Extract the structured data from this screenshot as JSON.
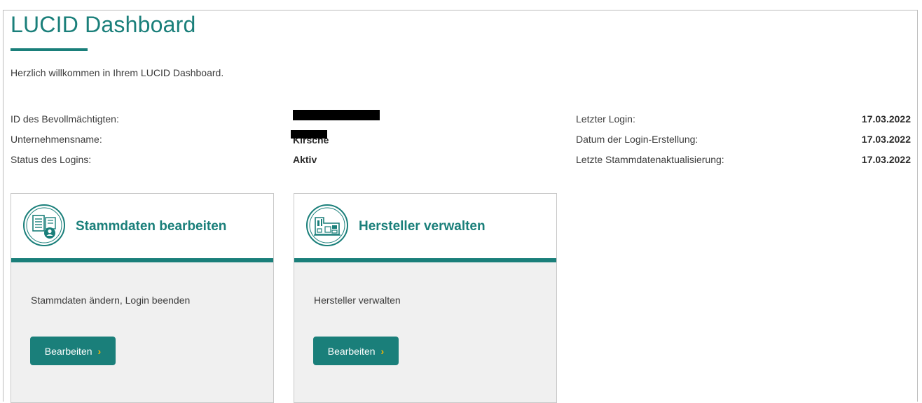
{
  "page": {
    "title": "LUCID Dashboard",
    "welcome": "Herzlich willkommen in Ihrem LUCID Dashboard."
  },
  "info_left": [
    {
      "label": "ID des Bevollmächtigten:",
      "value": "",
      "redacted": true
    },
    {
      "label": "Unternehmensname:",
      "value": "Kirsche",
      "redacted": true
    },
    {
      "label": "Status des Logins:",
      "value": "Aktiv",
      "redacted": false
    }
  ],
  "info_right": [
    {
      "label": "Letzter Login:",
      "value": "17.03.2022"
    },
    {
      "label": "Datum der Login-Erstellung:",
      "value": "17.03.2022"
    },
    {
      "label": "Letzte Stammdatenaktualisierung:",
      "value": "17.03.2022"
    }
  ],
  "cards": [
    {
      "title": "Stammdaten bearbeiten",
      "description": "Stammdaten ändern, Login beenden",
      "button_label": "Bearbeiten",
      "icon": "master-data-icon"
    },
    {
      "title": "Hersteller verwalten",
      "description": "Hersteller verwalten",
      "button_label": "Bearbeiten",
      "icon": "manufacturer-icon"
    }
  ],
  "colors": {
    "brand": "#1a7f7a",
    "chevron": "#f2b705",
    "card_body": "#f0f0f0"
  }
}
